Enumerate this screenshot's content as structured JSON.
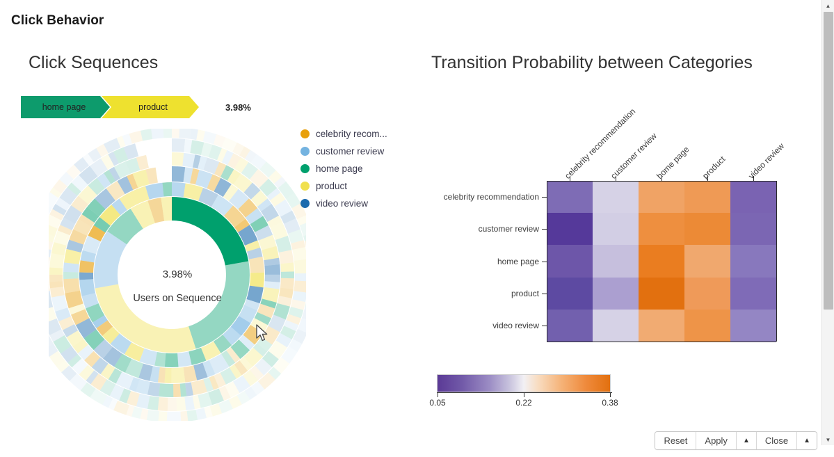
{
  "app": {
    "title": "Click Behavior"
  },
  "panels": {
    "left_title": "Click Sequences",
    "right_title": "Transition Probability between Categories"
  },
  "breadcrumb": {
    "steps": [
      {
        "label": "home page",
        "color": "#0d9b6c"
      },
      {
        "label": "product",
        "color": "#eee12f"
      }
    ],
    "percent": "3.98%"
  },
  "legend": {
    "items": [
      {
        "label": "celebrity recom...",
        "color": "#e8a00c"
      },
      {
        "label": "customer review",
        "color": "#74b3e0"
      },
      {
        "label": "home page",
        "color": "#00a06d"
      },
      {
        "label": "product",
        "color": "#f0e04e"
      },
      {
        "label": "video review",
        "color": "#1b6aad"
      }
    ]
  },
  "sunburst": {
    "center_value": "3.98%",
    "center_label": "Users on Sequence",
    "inner_ring": [
      {
        "category": "home page",
        "start": -90,
        "end": -10,
        "color": "#00a06d",
        "opacity": 1
      },
      {
        "category": "home page",
        "start": -10,
        "end": 72,
        "color": "#00a06d",
        "opacity": 0.42
      },
      {
        "category": "product",
        "start": 72,
        "end": 170,
        "color": "#f0e04e",
        "opacity": 0.42
      },
      {
        "category": "customer review",
        "start": 170,
        "end": 214,
        "color": "#74b3e0",
        "opacity": 0.42
      },
      {
        "category": "home page",
        "start": 214,
        "end": 238,
        "color": "#00a06d",
        "opacity": 0.42
      },
      {
        "category": "product",
        "start": 238,
        "end": 252,
        "color": "#f0e04e",
        "opacity": 0.42
      },
      {
        "category": "celebrity recom...",
        "start": 252,
        "end": 262,
        "color": "#e8a00c",
        "opacity": 0.42
      },
      {
        "category": "product",
        "start": 262,
        "end": 270,
        "color": "#f0e04e",
        "opacity": 0.42
      }
    ],
    "cursor": "mouse-pointer"
  },
  "chart_data": {
    "type": "heatmap",
    "title": "Transition Probability between Categories",
    "categories": [
      "celebrity recommendation",
      "customer review",
      "home page",
      "product",
      "video review"
    ],
    "x_tick_labels": [
      "celebrity recommendation",
      "customer review",
      "home page",
      "product",
      "video review"
    ],
    "y_tick_labels": [
      "celebrity recommendation",
      "customer review",
      "home page",
      "product",
      "video review"
    ],
    "xlabel": "",
    "ylabel": "",
    "grid": false,
    "colorbar": {
      "ticks": [
        "0.05",
        "0.22",
        "0.38"
      ],
      "tick_values": [
        0.05,
        0.22,
        0.38
      ],
      "vmin": 0.05,
      "vmax": 0.38,
      "colormap": "PuOr reversed (purple to orange)",
      "low_color": "#5b3a96",
      "mid_color": "#f2f0f4",
      "high_color": "#e2700f"
    },
    "values": [
      [
        0.12,
        0.2,
        0.31,
        0.32,
        0.12
      ],
      [
        0.08,
        0.2,
        0.33,
        0.33,
        0.13
      ],
      [
        0.11,
        0.19,
        0.35,
        0.3,
        0.14
      ],
      [
        0.09,
        0.17,
        0.38,
        0.31,
        0.13
      ],
      [
        0.12,
        0.2,
        0.3,
        0.32,
        0.14
      ]
    ],
    "cell_colors": [
      [
        "#7e6cb5",
        "#d6d2e6",
        "#f0a365",
        "#ef9a55",
        "#7a63b2"
      ],
      [
        "#55399a",
        "#d2cee4",
        "#ee8f3f",
        "#ec8a36",
        "#7b66b3"
      ],
      [
        "#6d56a9",
        "#c6bfdd",
        "#ea7d20",
        "#f0a86e",
        "#8878bd"
      ],
      [
        "#5d4aa2",
        "#ab9fd0",
        "#e2700f",
        "#ef9a59",
        "#7f6bb7"
      ],
      [
        "#7260ae",
        "#d6d2e6",
        "#f1ab72",
        "#ee9448",
        "#9486c4"
      ]
    ]
  },
  "toolbar": {
    "reset_label": "Reset",
    "apply_label": "Apply",
    "apply_arrow": "▲",
    "close_label": "Close",
    "close_arrow": "▲"
  },
  "scrollbar": {
    "up_arrow": "▲",
    "down_arrow": "▼"
  }
}
